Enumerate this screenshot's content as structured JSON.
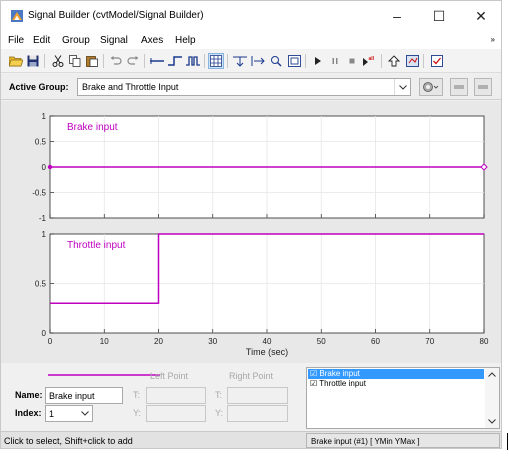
{
  "window": {
    "title": "Signal Builder (cvtModel/Signal Builder)",
    "minimize_glyph": "–",
    "maximize_glyph": "☐",
    "close_glyph": "✕"
  },
  "menu": {
    "items": [
      "File",
      "Edit",
      "Group",
      "Signal",
      "Axes",
      "Help"
    ],
    "overflow_glyph": "»"
  },
  "toolbar": {
    "icons": [
      "open-icon",
      "save-icon",
      "cut-icon",
      "copy-icon",
      "paste-icon",
      "undo-icon",
      "redo-icon",
      "constant-icon",
      "step-icon",
      "pulse-icon",
      "grid-icon",
      "snap-x-icon",
      "snap-y-icon",
      "zoom-xy-icon",
      "fit-icon",
      "play-icon",
      "pause-icon",
      "stop-icon",
      "run-all-icon",
      "up-icon",
      "import-icon",
      "verify-icon"
    ]
  },
  "group": {
    "label": "Active Group:",
    "value": "Brake and Throttle Input"
  },
  "colors": {
    "signal": "#bf00bf",
    "axes_bg": "#ffffff",
    "panel_bg": "#e8e8e8",
    "grid": "#e6e6e6",
    "selection": "#3399ff"
  },
  "chart_data": [
    {
      "type": "line",
      "title": "",
      "series": [
        {
          "name": "Brake input",
          "x": [
            0,
            80
          ],
          "y": [
            0,
            0
          ]
        }
      ],
      "xlim": [
        0,
        80
      ],
      "ylim": [
        -1,
        1
      ],
      "yticks": [
        "1",
        "0.5",
        "0",
        "-0.5",
        "-1"
      ],
      "grid": true,
      "label": "Brake input"
    },
    {
      "type": "line",
      "title": "",
      "series": [
        {
          "name": "Throttle input",
          "x": [
            0,
            20,
            20,
            80
          ],
          "y": [
            0.3,
            0.3,
            1,
            1
          ]
        }
      ],
      "xlim": [
        0,
        80
      ],
      "ylim": [
        0,
        1
      ],
      "xticks": [
        "0",
        "10",
        "20",
        "30",
        "40",
        "50",
        "60",
        "70",
        "80"
      ],
      "yticks": [
        "1",
        "0.5",
        "0"
      ],
      "xlabel": "Time (sec)",
      "grid": true,
      "label": "Throttle input"
    }
  ],
  "editor": {
    "left_point_label": "Left Point",
    "right_point_label": "Right Point",
    "name_label": "Name:",
    "name_value": "Brake input",
    "index_label": "Index:",
    "index_value": "1",
    "t_label": "T:",
    "y_label": "Y:"
  },
  "signals_list": {
    "items": [
      "☑ Brake input",
      "☑ Throttle input"
    ],
    "selected_index": 0
  },
  "status": {
    "left": "Click to select, Shift+click to add",
    "right": "Brake input (#1)  [ YMin YMax ]"
  }
}
